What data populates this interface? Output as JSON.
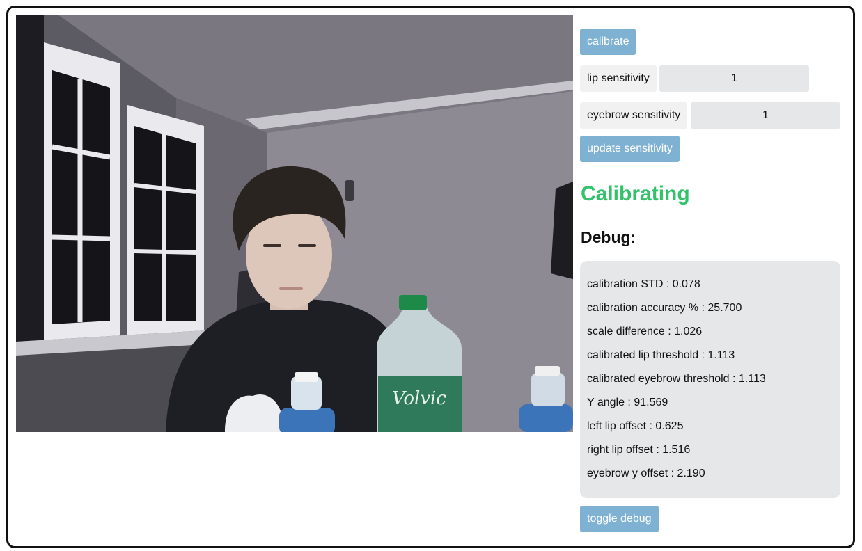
{
  "controls": {
    "calibrate_label": "calibrate",
    "lip_sensitivity_label": "lip sensitivity",
    "lip_sensitivity_value": "1",
    "eyebrow_sensitivity_label": "eyebrow sensitivity",
    "eyebrow_sensitivity_value": "1",
    "update_label": "update sensitivity",
    "toggle_debug_label": "toggle debug"
  },
  "status": {
    "text": "Calibrating",
    "color": "#33c26a"
  },
  "debug": {
    "title": "Debug:",
    "rows": [
      "calibration STD : 0.078",
      "calibration accuracy % : 25.700",
      "scale difference : 1.026",
      "calibrated lip threshold : 1.113",
      "calibrated eyebrow threshold : 1.113",
      "Y angle : 91.569",
      "left lip offset : 0.625",
      "right lip offset : 1.516",
      "eyebrow y offset : 2.190"
    ]
  },
  "colors": {
    "button": "#7fb1d3",
    "status": "#33c26a",
    "panel": "#e6e7e8"
  },
  "video": {
    "bottle_brand_text": "Volvic"
  }
}
